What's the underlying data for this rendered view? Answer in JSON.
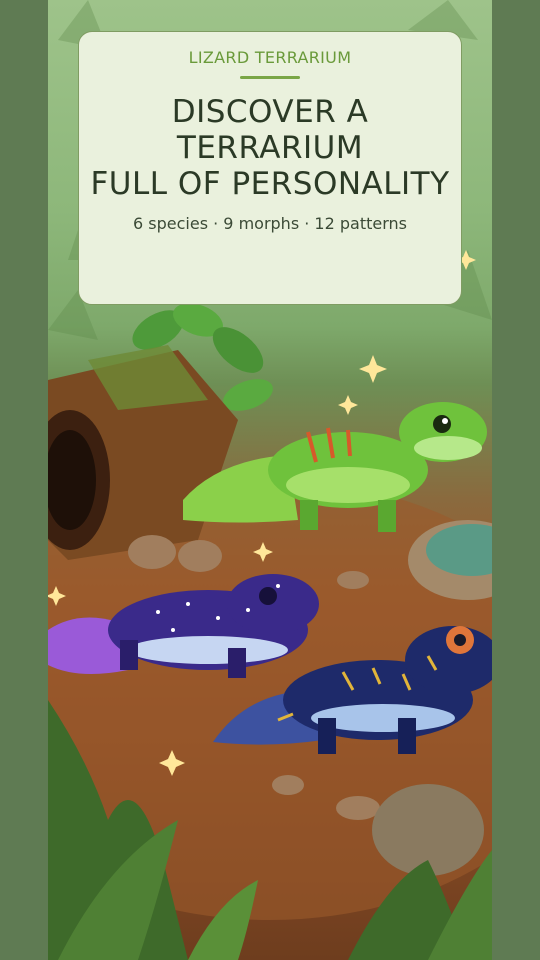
{
  "hero": {
    "eyebrow": "LIZARD TERRARIUM",
    "headline_line1": "DISCOVER A TERRARIUM",
    "headline_line2": "FULL OF PERSONALITY",
    "meta": "6 species · 9 morphs · 12 patterns"
  },
  "colors": {
    "side_panel": "#5f7b53",
    "card_bg": "#eaf1dd",
    "accent_green": "#6a9a3a",
    "headline_text": "#2b3a26"
  },
  "scene": {
    "lizards": [
      "green-gecko",
      "galaxy-purple-gecko",
      "navy-gold-gecko"
    ],
    "props": [
      "hollow-log",
      "water-dish",
      "pebbles",
      "ferns",
      "sparkles"
    ]
  }
}
